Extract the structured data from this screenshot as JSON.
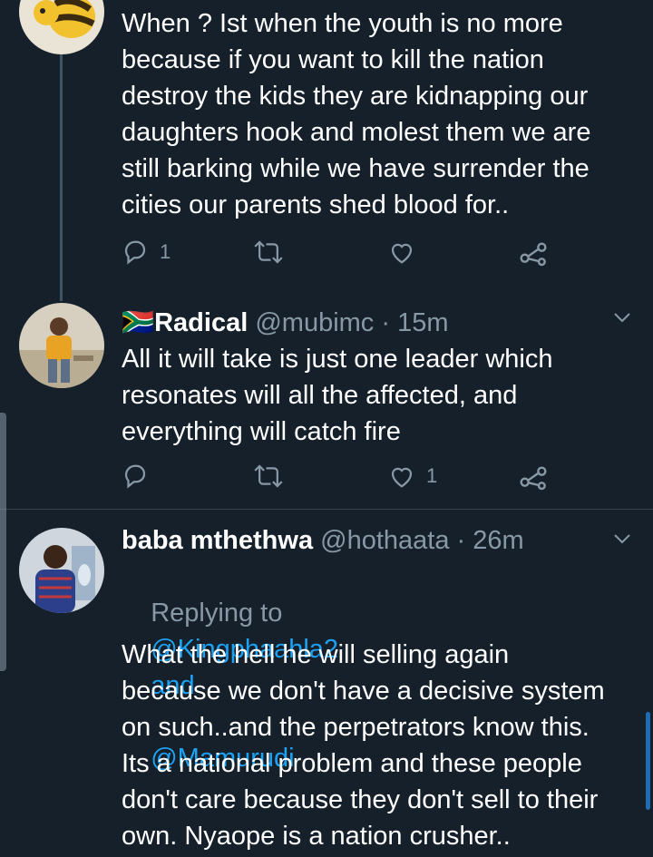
{
  "tweets": [
    {
      "text": "When ? Ist when the youth is no more\nbecause if you want to kill the nation\ndestroy the kids they are kidnapping our\ndaughters hook and molest them we are\nstill barking while we have surrender the\ncities our parents shed blood for..",
      "reply_count": "1",
      "like_count": ""
    },
    {
      "flag": "🇿🇦",
      "name": "Radical",
      "handle": "@mubimc",
      "time": "· 15m",
      "text": "All it will take is just one leader which\nresonates will all the affected, and\neverything will catch fire",
      "reply_count": "",
      "like_count": "1"
    },
    {
      "name": "baba mthethwa",
      "handle": "@hothaata",
      "time": "· 26m",
      "replying_prefix": "Replying to",
      "mention1": "@Kingphaahla2",
      "and_word": "and",
      "mention2": "@Mamurudi",
      "text": "What the hell he will selling again\nbecause we don't have a decisive system\non such..and the perpetrators know this.\nIts a national problem and these people\ndon't care because they don't sell to their\nown. Nyaope is a nation crusher.."
    }
  ],
  "colors": {
    "background": "#15202b",
    "text": "#ffffff",
    "muted": "#8899a6",
    "link": "#1da1f2",
    "divider": "#38444d"
  },
  "icons": [
    "reply-icon",
    "retweet-icon",
    "like-icon",
    "share-icon",
    "chevron-down-icon"
  ]
}
